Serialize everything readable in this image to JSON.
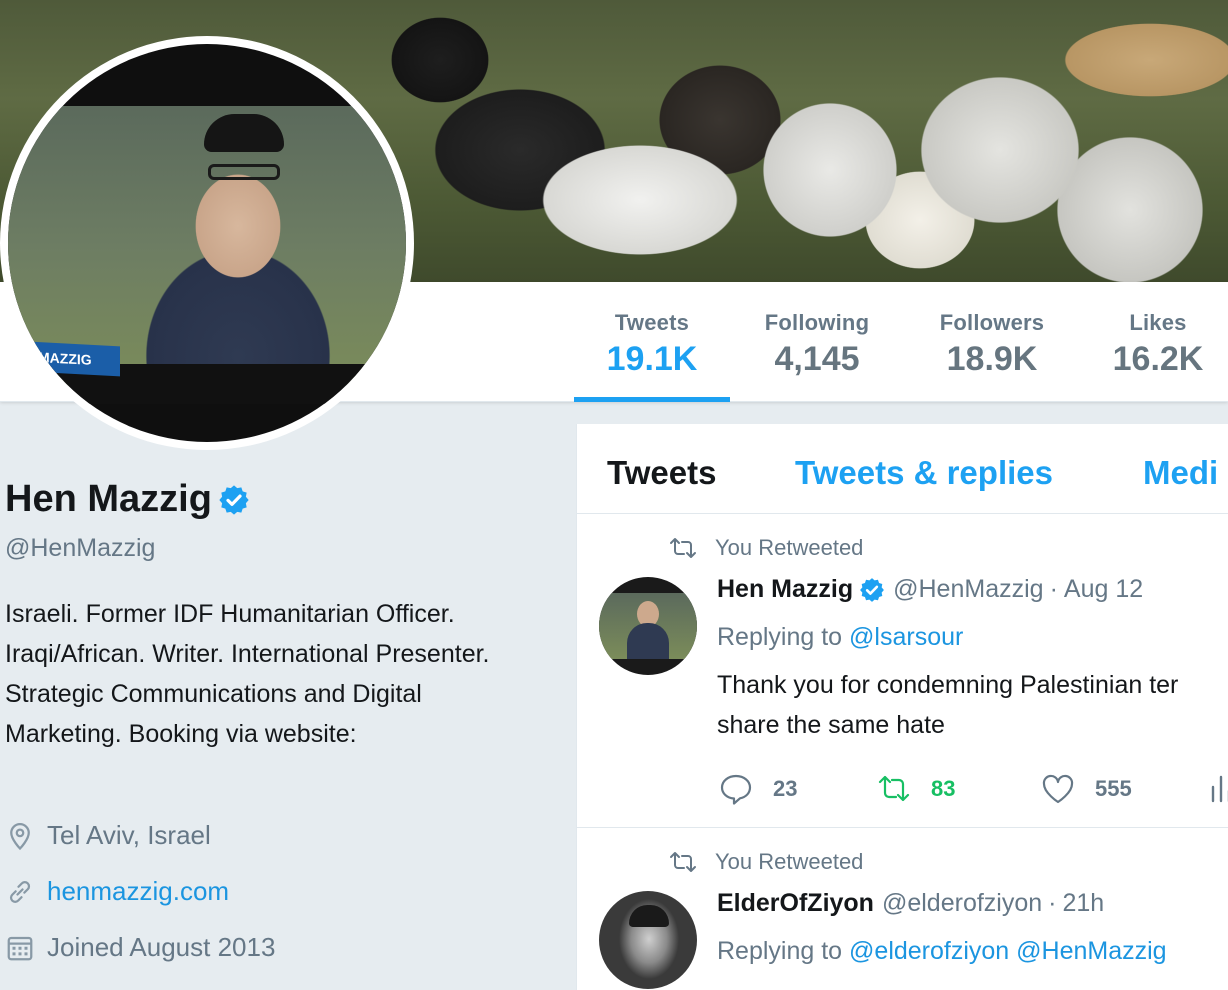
{
  "profile": {
    "name": "Hen Mazzig",
    "handle": "@HenMazzig",
    "bio": "Israeli. Former IDF Humanitarian Officer. Iraqi/African. Writer. International Presenter. Strategic Communications and Digital Marketing. Booking via website:",
    "location": "Tel Aviv, Israel",
    "website": "henmazzig.com",
    "joined": "Joined August 2013",
    "avatar_plate_text": "MAZZIG"
  },
  "stats": [
    {
      "label": "Tweets",
      "value": "19.1K",
      "active": true
    },
    {
      "label": "Following",
      "value": "4,145",
      "active": false
    },
    {
      "label": "Followers",
      "value": "18.9K",
      "active": false
    },
    {
      "label": "Likes",
      "value": "16.2K",
      "active": false
    }
  ],
  "tabs": [
    {
      "label": "Tweets",
      "active": true
    },
    {
      "label": "Tweets & replies",
      "active": false
    },
    {
      "label": "Medi",
      "active": false
    }
  ],
  "tweets": [
    {
      "context": "You Retweeted",
      "name": "Hen Mazzig",
      "verified": true,
      "handle": "@HenMazzig",
      "sep": "·",
      "time": "Aug 12",
      "replying_prefix": "Replying to",
      "replying_to": "@lsarsour",
      "text_lines": [
        "Thank you for condemning Palestinian ter",
        "share the same hate"
      ],
      "replies": "23",
      "retweets": "83",
      "likes": "555"
    },
    {
      "context": "You Retweeted",
      "name": "ElderOfZiyon",
      "verified": false,
      "handle": "@elderofziyon",
      "sep": "·",
      "time": "21h",
      "replying_prefix": "Replying to",
      "replying_to": "@elderofziyon @HenMazzig"
    }
  ],
  "colors": {
    "accent": "#1da1f2",
    "link": "#1b95e0",
    "retweet_green": "#17bf63",
    "muted": "#657786",
    "background": "#e6ecf0"
  }
}
